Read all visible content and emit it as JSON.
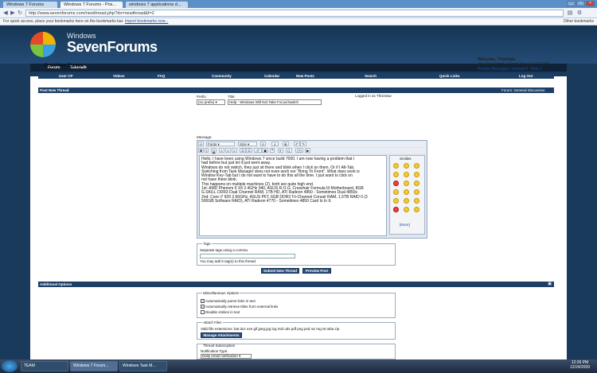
{
  "browser": {
    "tabs": [
      {
        "label": "Windows 7 Forums"
      },
      {
        "label": "Windows 7 Forums - Pos..."
      },
      {
        "label": "windows 7 applications d..."
      }
    ],
    "url": "http://www.sevenforums.com/newthread.php?do=newthread&f=2",
    "bookmarks_text": "For quick access, place your bookmarks here on the bookmarks bar.",
    "import_link": "Import bookmarks now...",
    "other_bookmarks": "Other bookmarks"
  },
  "site": {
    "logo_small": "Windows",
    "logo_big": "SevenForums",
    "nav": [
      "Forum",
      "Tutorials"
    ]
  },
  "breadcrumb": {
    "path": [
      "Windows 7 Forums",
      "Seven Forums",
      "General Discussion"
    ],
    "title": "Post New Thread"
  },
  "welcome": {
    "line1": "Welcome, ThisisIaw.",
    "line2": "You last visited: 4 Days Ago at 12:13 AM",
    "line3": "Private Messages: Unread 0, Total 1."
  },
  "subnav": [
    "User CP",
    "Videos",
    "FAQ",
    "Community",
    "Calendar",
    "New Posts",
    "Search",
    "Quick Links",
    "Log Out"
  ],
  "post": {
    "bar_title": "Post New Thread",
    "forum_label": "Forum: General Discussion",
    "prefix_label": "Prefix:",
    "prefix_value": "(no prefix)",
    "title_label": "Title:",
    "title_value": "Help - Windows Will Not Take Focus/Switch",
    "logged_in": "Logged in as ThisisIaw",
    "message_label": "Message:",
    "font_value": "Fonts",
    "size_value": "Size",
    "message_lines": [
      "Hello. I have been using Windows 7 since build 7000. I am now having a problem that I",
      "had before but just let it just went away.",
      "Windows do not switch, they just sit there and blink when I click on them. Or if I Alt-Tab.",
      "Switching from Task Manager does not even work nor \"Bring To Front\". What does work is",
      "Window Key-Tab but I do not want to have to do this all the time. I just want to click on",
      "not have there blink.",
      "This happens on multiple machines (2), both are quite high end.",
      "1st: AMD Phenom II X4 2.4GHz 940, ASUS R.O.G. Crosshair Formula III Motherboard, 8GB",
      "G.SKILL DDR3 Dual Channel RAM, 1TB HD, ATI Radeon 4850 - Sometimes Dual 4850s",
      "2nd: Core i7 920 2.66GHz, ASUS P6T, 6GB DDR3 Tri-Channel Corsair RAM, 1.5TB RAID 0 (3",
      "500GB Software RAID), ATI Radeon 4770 - Sometimes 4850 Card Is In It."
    ],
    "smilies_title": "Smilies",
    "smilies_more": "[More]"
  },
  "tags": {
    "title": "Tags",
    "hint": "Separate tags using a comma.",
    "remaining": "You may add 5 tag(s) to this thread."
  },
  "buttons": {
    "submit": "Submit New Thread",
    "preview": "Preview Post"
  },
  "options": {
    "title": "Additional Options",
    "misc_title": "Miscellaneous Options",
    "misc": [
      {
        "label": "Automatically parse links in text",
        "checked": true
      },
      {
        "label": "Automatically retrieve titles from external links",
        "checked": true
      },
      {
        "label": "Disable smilies in text",
        "checked": false
      }
    ],
    "attach_title": "Attach Files",
    "attach_ext": "Valid file extensions: bat doc exe gif jpeg jpg log mid ods pdf png psd rar reg txt wba zip",
    "attach_button": "Manage Attachments",
    "sub_title": "Thread Subscription",
    "notif_label": "Notification Type:",
    "notif_value": "Daily email notification"
  },
  "taskbar": {
    "items": [
      "TEAM",
      "Windows 7 Forum...",
      "Windows Task M..."
    ],
    "time": "12:26 PM",
    "date": "12/24/2009"
  }
}
